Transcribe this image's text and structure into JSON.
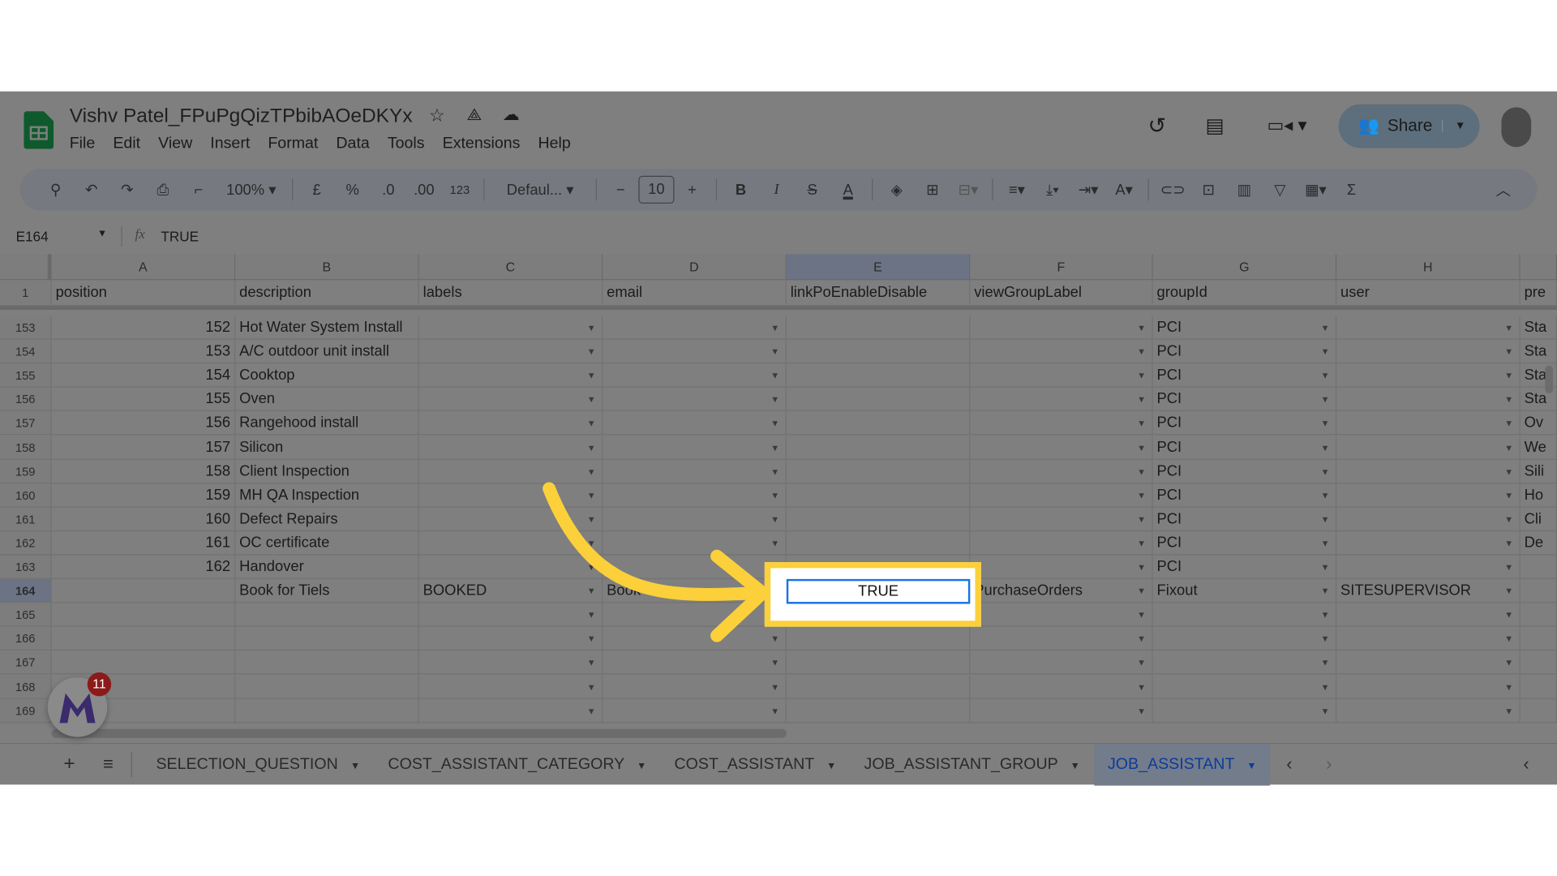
{
  "doc": {
    "title": "Vishv Patel_FPuPgQizTPbibAOeDKYx",
    "menu": [
      "File",
      "Edit",
      "View",
      "Insert",
      "Format",
      "Data",
      "Tools",
      "Extensions",
      "Help"
    ],
    "share_label": "Share"
  },
  "toolbar": {
    "zoom": "100%",
    "currency": "£",
    "percent": "%",
    "dec_less": ".0",
    "dec_more": ".00",
    "format_123": "123",
    "font": "Defaul...",
    "font_size": "10",
    "bold": "B",
    "italic": "I",
    "sum": "Σ"
  },
  "formula": {
    "cell_ref": "E164",
    "fx": "fx",
    "value": "TRUE"
  },
  "columns": [
    "A",
    "B",
    "C",
    "D",
    "E",
    "F",
    "G",
    "H",
    ""
  ],
  "header_row": {
    "num": "1",
    "cells": [
      "position",
      "description",
      "labels",
      "email",
      "linkPoEnableDisable",
      "viewGroupLabel",
      "groupId",
      "user",
      "pre"
    ]
  },
  "rows": [
    {
      "num": "153",
      "a": "152",
      "b": "Hot Water System Install",
      "c": "",
      "d": "",
      "e": "",
      "f": "",
      "g": "PCI",
      "h": "",
      "i": "Sta"
    },
    {
      "num": "154",
      "a": "153",
      "b": "A/C outdoor unit install",
      "c": "",
      "d": "",
      "e": "",
      "f": "",
      "g": "PCI",
      "h": "",
      "i": "Sta"
    },
    {
      "num": "155",
      "a": "154",
      "b": "Cooktop",
      "c": "",
      "d": "",
      "e": "",
      "f": "",
      "g": "PCI",
      "h": "",
      "i": "Sta"
    },
    {
      "num": "156",
      "a": "155",
      "b": "Oven",
      "c": "",
      "d": "",
      "e": "",
      "f": "",
      "g": "PCI",
      "h": "",
      "i": "Sta"
    },
    {
      "num": "157",
      "a": "156",
      "b": "Rangehood install",
      "c": "",
      "d": "",
      "e": "",
      "f": "",
      "g": "PCI",
      "h": "",
      "i": "Ov"
    },
    {
      "num": "158",
      "a": "157",
      "b": "Silicon",
      "c": "",
      "d": "",
      "e": "",
      "f": "",
      "g": "PCI",
      "h": "",
      "i": "We"
    },
    {
      "num": "159",
      "a": "158",
      "b": "Client Inspection",
      "c": "",
      "d": "",
      "e": "",
      "f": "",
      "g": "PCI",
      "h": "",
      "i": "Sili"
    },
    {
      "num": "160",
      "a": "159",
      "b": "MH QA Inspection",
      "c": "",
      "d": "",
      "e": "",
      "f": "",
      "g": "PCI",
      "h": "",
      "i": "Ho"
    },
    {
      "num": "161",
      "a": "160",
      "b": "Defect Repairs",
      "c": "",
      "d": "",
      "e": "",
      "f": "",
      "g": "PCI",
      "h": "",
      "i": "Cli"
    },
    {
      "num": "162",
      "a": "161",
      "b": "OC certificate",
      "c": "",
      "d": "",
      "e": "",
      "f": "",
      "g": "PCI",
      "h": "",
      "i": "De"
    },
    {
      "num": "163",
      "a": "162",
      "b": "Handover",
      "c": "",
      "d": "",
      "e": "",
      "f": "",
      "g": "PCI",
      "h": "",
      "i": ""
    },
    {
      "num": "164",
      "a": "",
      "b": "Book for Tiels",
      "c": "BOOKED",
      "d": "Book",
      "e": "TRUE",
      "f": "PurchaseOrders",
      "g": "Fixout",
      "h": "SITESUPERVISOR",
      "i": ""
    },
    {
      "num": "165",
      "a": "",
      "b": "",
      "c": "",
      "d": "",
      "e": "",
      "f": "",
      "g": "",
      "h": "",
      "i": ""
    },
    {
      "num": "166",
      "a": "",
      "b": "",
      "c": "",
      "d": "",
      "e": "",
      "f": "",
      "g": "",
      "h": "",
      "i": ""
    },
    {
      "num": "167",
      "a": "",
      "b": "",
      "c": "",
      "d": "",
      "e": "",
      "f": "",
      "g": "",
      "h": "",
      "i": ""
    },
    {
      "num": "168",
      "a": "",
      "b": "",
      "c": "",
      "d": "",
      "e": "",
      "f": "",
      "g": "",
      "h": "",
      "i": ""
    },
    {
      "num": "169",
      "a": "",
      "b": "",
      "c": "",
      "d": "",
      "e": "",
      "f": "",
      "g": "",
      "h": "",
      "i": ""
    }
  ],
  "sheets": [
    {
      "label": "SELECTION_QUESTION",
      "active": false
    },
    {
      "label": "COST_ASSISTANT_CATEGORY",
      "active": false
    },
    {
      "label": "COST_ASSISTANT",
      "active": false
    },
    {
      "label": "JOB_ASSISTANT_GROUP",
      "active": false
    },
    {
      "label": "JOB_ASSISTANT",
      "active": true
    }
  ],
  "badge": {
    "count": "11"
  },
  "colors": {
    "highlight": "#fcd03a",
    "selection": "#1a73e8",
    "overlay": "#7f7f7f",
    "active_tab": "#0b3b9c"
  }
}
